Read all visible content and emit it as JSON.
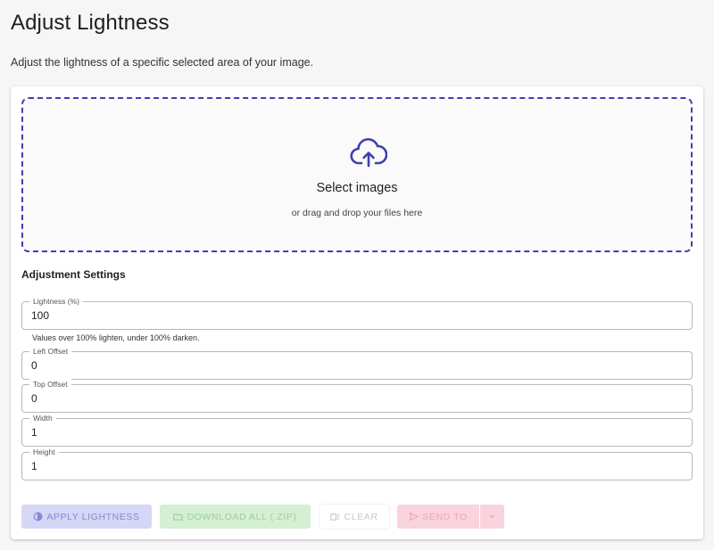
{
  "page": {
    "title": "Adjust Lightness",
    "description": "Adjust the lightness of a specific selected area of your image."
  },
  "dropzone": {
    "icon": "cloud-upload-icon",
    "title": "Select images",
    "subtitle": "or drag and drop your files here",
    "border_color": "#3f3fb0"
  },
  "settings": {
    "title": "Adjustment Settings",
    "fields": [
      {
        "label": "Lightness (%)",
        "value": "100",
        "helper": "Values over 100% lighten, under 100% darken."
      },
      {
        "label": "Left Offset",
        "value": "0"
      },
      {
        "label": "Top Offset",
        "value": "0"
      },
      {
        "label": "Width",
        "value": "1"
      },
      {
        "label": "Height",
        "value": "1"
      }
    ]
  },
  "actions": {
    "apply": {
      "label": "Apply Lightness",
      "icon": "lightness-icon",
      "color": "#8888d6"
    },
    "download": {
      "label": "Download All (.zip)",
      "icon": "folder-icon",
      "color": "#9cd09a"
    },
    "clear": {
      "label": "Clear",
      "icon": "clear-icon"
    },
    "send": {
      "label": "Send To",
      "icon": "send-icon",
      "color": "#f0a6b8"
    },
    "send_menu": {
      "icon": "caret-down-icon"
    }
  }
}
